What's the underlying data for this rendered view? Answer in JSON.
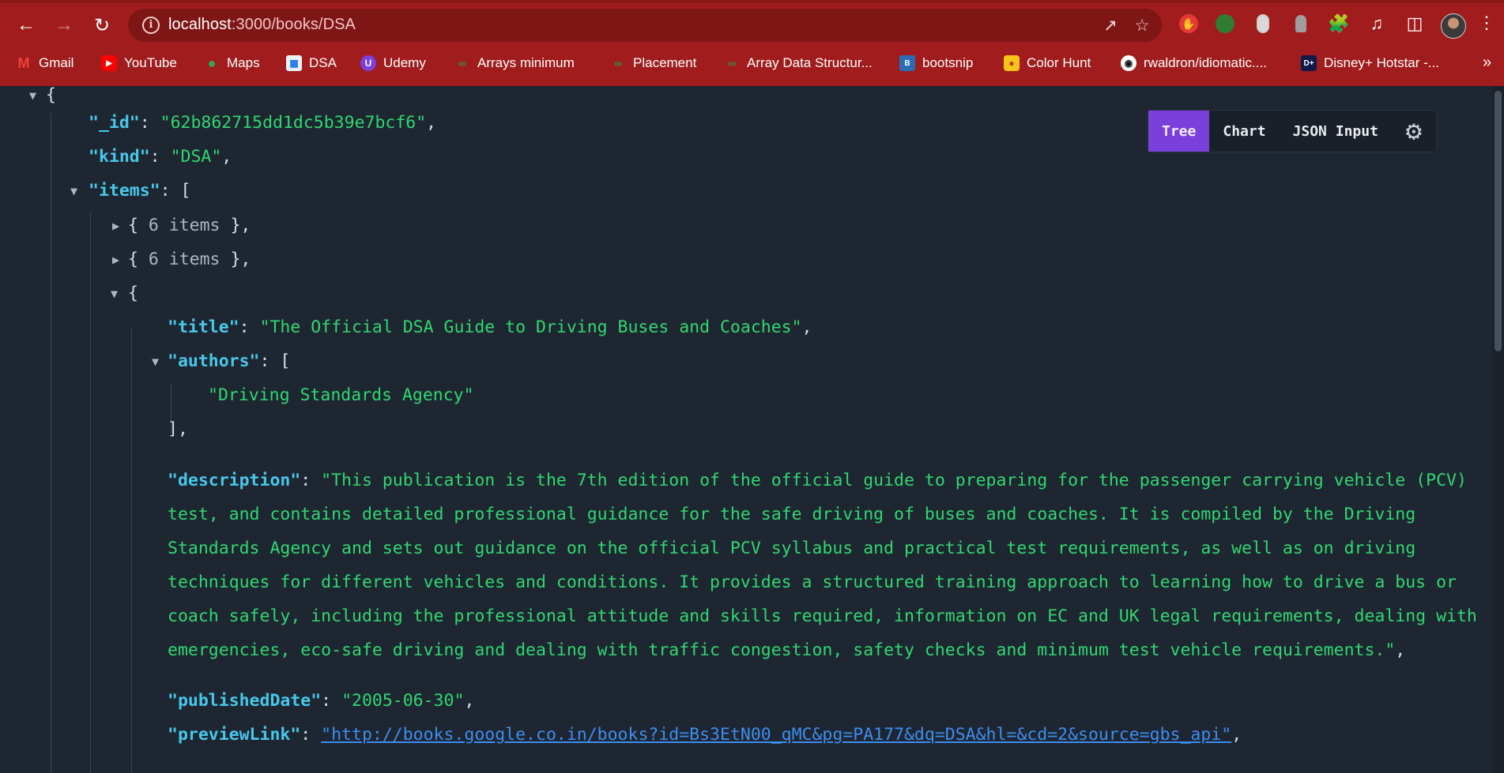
{
  "browser": {
    "url_host": "localhost",
    "url_rest": ":3000/books/DSA",
    "bookmarks": [
      {
        "label": "Gmail",
        "icon": "gmail-icon"
      },
      {
        "label": "YouTube",
        "icon": "youtube-icon"
      },
      {
        "label": "Maps",
        "icon": "maps-icon"
      },
      {
        "label": "DSA",
        "icon": "bookmark-icon"
      },
      {
        "label": "Udemy",
        "icon": "udemy-icon"
      },
      {
        "label": "Arrays minimum",
        "icon": "gfg-icon"
      },
      {
        "label": "Placement",
        "icon": "gfg-icon"
      },
      {
        "label": "Array Data Structur...",
        "icon": "gfg-icon"
      },
      {
        "label": "bootsnip",
        "icon": "bootsnipp-icon"
      },
      {
        "label": "Color Hunt",
        "icon": "colorhunt-icon"
      },
      {
        "label": "rwaldron/idiomatic....",
        "icon": "github-icon"
      },
      {
        "label": "Disney+ Hotstar -...",
        "icon": "hotstar-icon"
      }
    ],
    "bookmark_more": "»",
    "accent_color": "#a11d1d"
  },
  "toolbar": {
    "tabs": [
      "Tree",
      "Chart",
      "JSON Input"
    ],
    "active_tab": "Tree",
    "active_color": "#7b3fdc"
  },
  "json": {
    "open_brace": "{",
    "id_key": "\"_id\"",
    "id_value": "\"62b862715dd1dc5b39e7bcf6\"",
    "kind_key": "\"kind\"",
    "kind_value": "\"DSA\"",
    "items_key": "\"items\"",
    "collapsed_items_label": "6 items",
    "title_key": "\"title\"",
    "title_value": "\"The Official DSA Guide to Driving Buses and Coaches\"",
    "authors_key": "\"authors\"",
    "author_0": "\"Driving Standards Agency\"",
    "description_key": "\"description\"",
    "description_value": "\"This publication is the 7th edition of the official guide to preparing for the passenger carrying vehicle (PCV) test, and contains detailed professional guidance for the safe driving of buses and coaches. It is compiled by the Driving Standards Agency and sets out guidance on the official PCV syllabus and practical test requirements, as well as on driving techniques for different vehicles and conditions. It provides a structured training approach to learning how to drive a bus or coach safely, including the professional attitude and skills required, information on EC and UK legal requirements, dealing with emergencies, eco-safe driving and dealing with traffic congestion, safety checks and minimum test vehicle requirements.\"",
    "published_key": "\"publishedDate\"",
    "published_value": "\"2005-06-30\"",
    "preview_key": "\"previewLink\"",
    "preview_value": "\"http://books.google.co.in/books?id=Bs3EtN00_qMC&pg=PA177&dq=DSA&hl=&cd=2&source=gbs_api\""
  }
}
